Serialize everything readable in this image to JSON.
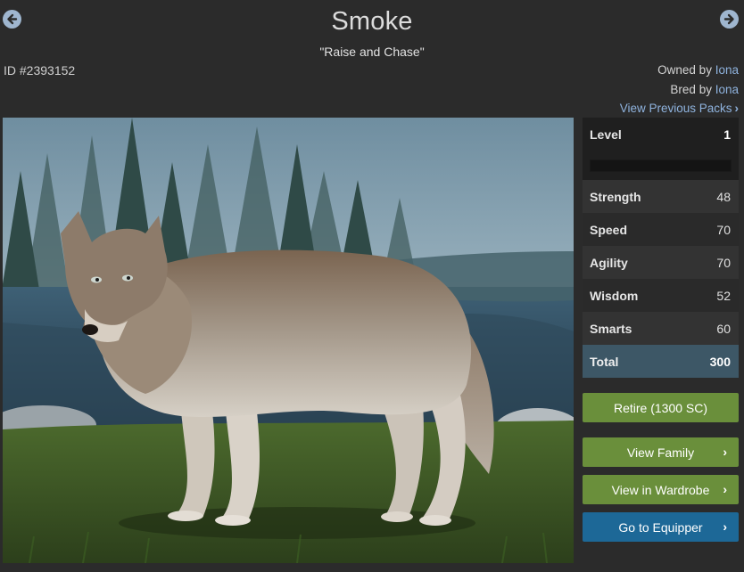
{
  "header": {
    "name": "Smoke",
    "subtitle": "\"Raise and Chase\"",
    "id_text": "ID #2393152",
    "owned_prefix": "Owned by",
    "owner": "Iona",
    "bred_prefix": "Bred by",
    "breeder": "Iona",
    "previous_packs": "View Previous Packs"
  },
  "stats": {
    "level_label": "Level",
    "level_value": "1",
    "xp_progress": 0.0,
    "rows": [
      {
        "label": "Strength",
        "value": "48"
      },
      {
        "label": "Speed",
        "value": "70"
      },
      {
        "label": "Agility",
        "value": "70"
      },
      {
        "label": "Wisdom",
        "value": "52"
      },
      {
        "label": "Smarts",
        "value": "60"
      }
    ],
    "total_label": "Total",
    "total_value": "300"
  },
  "actions": {
    "retire": "Retire (1300 SC)",
    "family": "View Family",
    "wardrobe": "View in Wardrobe",
    "equipper": "Go to Equipper"
  },
  "colors": {
    "accent_link": "#8fb3de",
    "button_green": "#6a8f3b",
    "button_blue": "#1d6897",
    "total_row": "#3d5766"
  },
  "icons": {
    "prev": "arrow-left-circle-icon",
    "next": "arrow-right-circle-icon",
    "chevron": "chevron-right-icon"
  }
}
